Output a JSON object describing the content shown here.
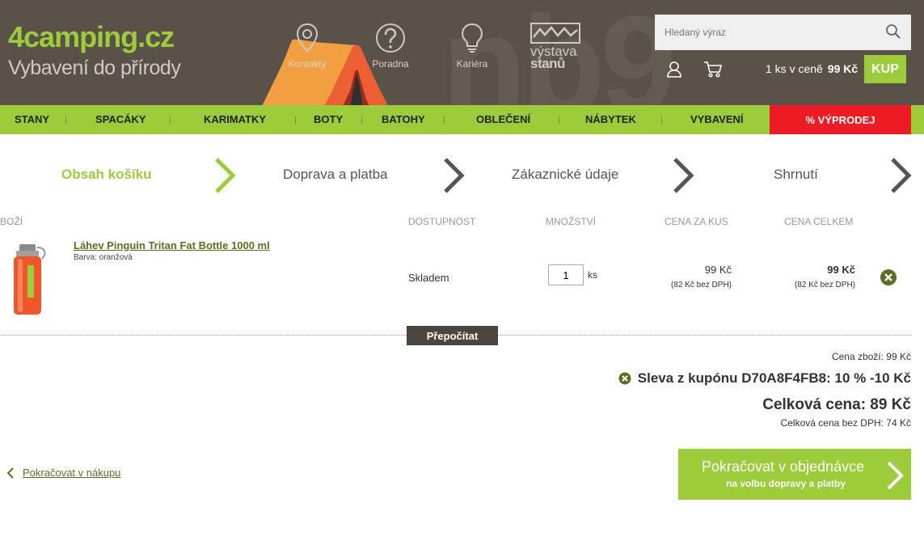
{
  "header": {
    "logo_prefix": "4",
    "logo_mid": "camping",
    "logo_suffix": ".cz",
    "tagline": "Vybavení do přírody",
    "links": [
      {
        "label": "Kontakty",
        "icon": "location-pin-icon"
      },
      {
        "label": "Poradna",
        "icon": "question-icon"
      },
      {
        "label": "Kariéra",
        "icon": "lightbulb-icon"
      }
    ],
    "vystava_line1": "výstava",
    "vystava_line2": "stanů",
    "search_placeholder": "Hledaný výraz",
    "cart_text": "1 ks v ceně",
    "cart_price": "99 Kč",
    "buy_label": "KUP"
  },
  "nav": {
    "items": [
      "STANY",
      "SPACÁKY",
      "KARIMATKY",
      "BOTY",
      "BATOHY",
      "OBLEČENÍ",
      "NÁBYTEK",
      "VYBAVENÍ"
    ],
    "sale": "% VÝPRODEJ"
  },
  "steps": [
    "Obsah košíku",
    "Doprava a platba",
    "Zákaznické údaje",
    "Shrnutí"
  ],
  "table": {
    "headers": [
      "BOŽÍ",
      "DOSTUPNOST",
      "MNOŽSTVÍ",
      "CENA ZA KUS",
      "CENA CELKEM"
    ],
    "row": {
      "name": "Láhev Pinguin Tritan Fat Bottle 1000 ml",
      "attr": "Barva: oranžová",
      "availability": "Skladem",
      "qty": "1",
      "unit": "ks",
      "unit_price": "99 Kč",
      "unit_price_net": "(82 Kč bez DPH)",
      "total_price": "99 Kč",
      "total_price_net": "(82 Kč bez DPH)"
    }
  },
  "recalc_label": "Přepočítat",
  "summary": {
    "goods": "Cena zboží: 99 Kč",
    "coupon": "Sleva z kupónu D70A8F4FB8: 10 % -10 Kč",
    "total": "Celková cena: 89 Kč",
    "total_net": "Celková cena bez DPH: 74 Kč"
  },
  "back_label": "Pokračovat v nákupu",
  "continue": {
    "title": "Pokračovat v objednávce",
    "subtitle": "na volbu dopravy a platby"
  },
  "colors": {
    "accent": "#9ccc3a",
    "header_bg": "#5a5249",
    "sale": "#ed1c24"
  }
}
